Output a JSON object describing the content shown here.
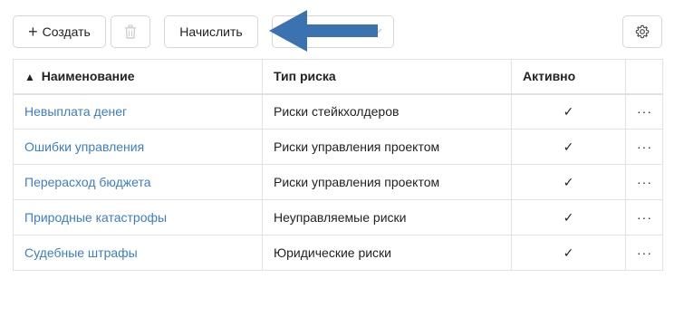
{
  "toolbar": {
    "create_label": "Создать",
    "create_icon": "plus-icon",
    "delete_icon": "trash-icon",
    "accrue_label": "Начислить",
    "settings_icon": "gear-icon"
  },
  "annotation": {
    "arrow_color": "#3b72b0"
  },
  "table": {
    "sort_mark": "▲",
    "columns": [
      "Наименование",
      "Тип риска",
      "Активно",
      ""
    ],
    "rows": [
      {
        "name": "Невыплата денег",
        "type": "Риски стейкхолдеров",
        "active": "✓",
        "menu": "···"
      },
      {
        "name": "Ошибки управления",
        "type": "Риски управления проектом",
        "active": "✓",
        "menu": "···"
      },
      {
        "name": "Перерасход бюджета",
        "type": "Риски управления проектом",
        "active": "✓",
        "menu": "···"
      },
      {
        "name": "Природные катастрофы",
        "type": "Неуправляемые риски",
        "active": "✓",
        "menu": "···"
      },
      {
        "name": "Судебные штрафы",
        "type": "Юридические риски",
        "active": "✓",
        "menu": "···"
      }
    ]
  },
  "colors": {
    "link": "#3b7ec7",
    "border": "#e2e2e2"
  }
}
